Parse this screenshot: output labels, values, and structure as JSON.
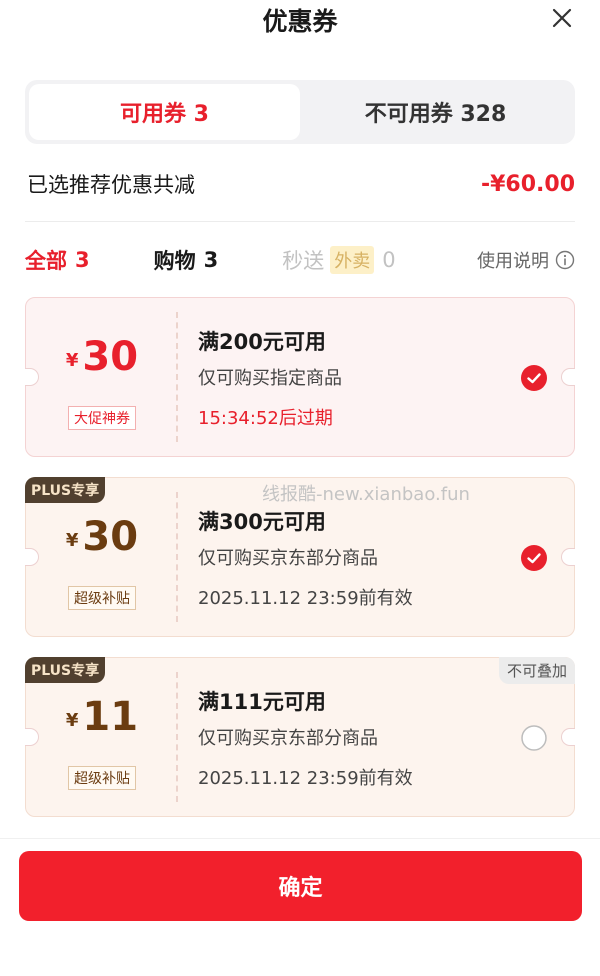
{
  "header": {
    "title": "优惠券"
  },
  "tabs": [
    {
      "label": "可用券 3",
      "active": true
    },
    {
      "label": "不可用券 328",
      "active": false
    }
  ],
  "summary": {
    "label": "已选推荐优惠共减",
    "amount": "-¥60.00"
  },
  "filters": [
    {
      "label": "全部",
      "count": "3",
      "state": "active"
    },
    {
      "label": "购物",
      "count": "3",
      "state": "normal"
    },
    {
      "label": "秒送",
      "tag": "外卖",
      "count": "0",
      "state": "disabled"
    }
  ],
  "help_label": "使用说明",
  "coupons": [
    {
      "currency": "¥",
      "amount": "30",
      "tag": "大促神券",
      "condition": "满200元可用",
      "scope": "仅可购买指定商品",
      "expiry": "15:34:52后过期",
      "selected": true
    },
    {
      "badge": "PLUS专享",
      "currency": "¥",
      "amount": "30",
      "tag": "超级补贴",
      "condition": "满300元可用",
      "scope": "仅可购买京东部分商品",
      "expiry": "2025.11.12 23:59前有效",
      "selected": true
    },
    {
      "badge": "PLUS专享",
      "corner": "不可叠加",
      "currency": "¥",
      "amount": "11",
      "tag": "超级补贴",
      "condition": "满111元可用",
      "scope": "仅可购买京东部分商品",
      "expiry": "2025.11.12 23:59前有效",
      "selected": false
    }
  ],
  "watermark": "线报酷-new.xianbao.fun",
  "confirm_label": "确定",
  "colors": {
    "accent": "#e8202c",
    "button": "#f2202c",
    "plus_badge": "#51402f"
  }
}
